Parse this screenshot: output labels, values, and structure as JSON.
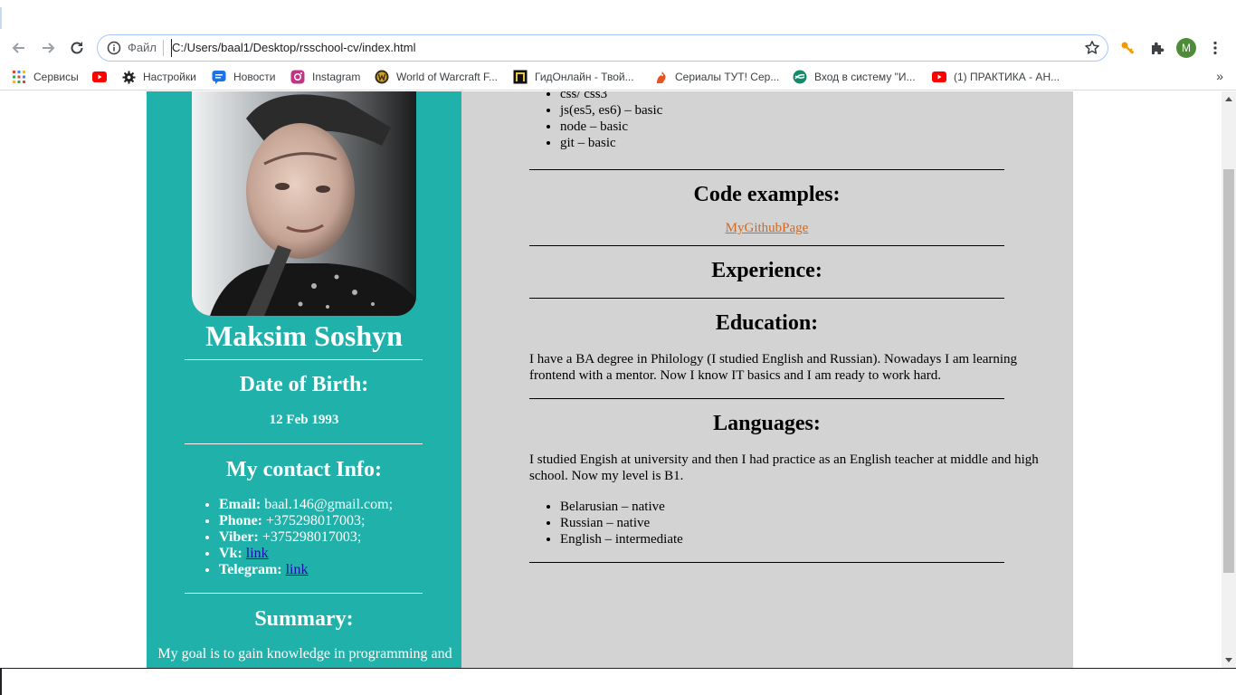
{
  "browser": {
    "scheme_label": "Файл",
    "url": "C:/Users/baal1/Desktop/rsschool-cv/index.html",
    "profile_initial": "M",
    "bookmarks": [
      {
        "label": "Сервисы",
        "icon": "apps-grid-icon"
      },
      {
        "label": "",
        "icon": "youtube-icon"
      },
      {
        "label": "Настройки",
        "icon": "gear-icon"
      },
      {
        "label": "Новости",
        "icon": "news-icon"
      },
      {
        "label": "Instagram",
        "icon": "instagram-icon"
      },
      {
        "label": "World of Warcraft F...",
        "icon": "warcraft-icon"
      },
      {
        "label": "ГидОнлайн - Твой...",
        "icon": "gidonline-icon"
      },
      {
        "label": "Сериалы ТУТ! Сер...",
        "icon": "cat-icon"
      },
      {
        "label": "Вход в систему \"И...",
        "icon": "login-logo-icon"
      },
      {
        "label": "(1) ПРАКТИКА - АН...",
        "icon": "youtube-icon"
      }
    ],
    "bookmarks_overflow": "»"
  },
  "sidebar": {
    "name": "Maksim Soshyn",
    "dob_heading": "Date of Birth:",
    "dob_value": "12 Feb 1993",
    "contact_heading": "My contact Info:",
    "contacts": [
      {
        "label": "Email:",
        "value": "baal.146@gmail.com;"
      },
      {
        "label": "Phone:",
        "value": "+375298017003;"
      },
      {
        "label": "Viber:",
        "value": "+375298017003;"
      },
      {
        "label": "Vk:",
        "link": "link"
      },
      {
        "label": "Telegram:",
        "link": "link"
      }
    ],
    "summary_heading": "Summary:",
    "summary_text": "My goal is to gain knowledge in programming and"
  },
  "main": {
    "skills": [
      "css/ css3",
      "js(es5, es6) – basic",
      "node – basic",
      "git – basic"
    ],
    "code_heading": "Code examples:",
    "code_link": "MyGithubPage",
    "experience_heading": "Experience:",
    "education_heading": "Education:",
    "education_text": "I have a BA degree in Philology (I studied English and Russian). Nowadays I am learning frontend with a mentor. Now I know IT basics and I am ready to work hard.",
    "languages_heading": "Languages:",
    "languages_text": "I studied Engish at university and then I had practice as an English teacher at middle and high school. Now my level is B1.",
    "languages": [
      "Belarusian – native",
      "Russian – native",
      "English – intermediate"
    ]
  },
  "colors": {
    "sidebar_bg": "#20b2aa",
    "main_bg": "#d3d3d3",
    "link_orange": "#d2691e",
    "profile_green": "#4e8c3a"
  }
}
